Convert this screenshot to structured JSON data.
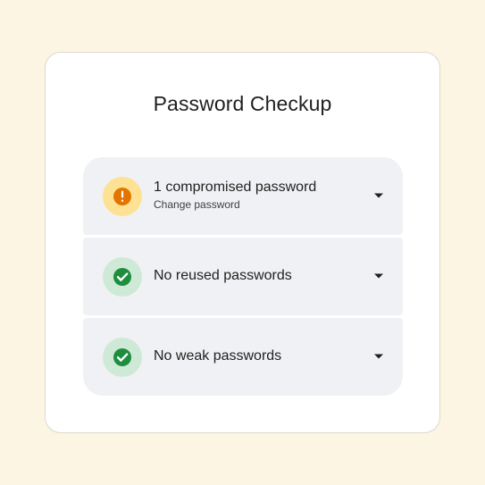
{
  "title": "Password Checkup",
  "items": [
    {
      "label": "1 compromised password",
      "sublabel": "Change password",
      "status": "warning",
      "status_icon": "exclamation-icon"
    },
    {
      "label": "No reused passwords",
      "status": "ok",
      "status_icon": "check-icon"
    },
    {
      "label": "No weak passwords",
      "status": "ok",
      "status_icon": "check-icon"
    }
  ],
  "colors": {
    "background": "#fdf5e3",
    "warning_bg": "#fde293",
    "warning_fg": "#e37400",
    "ok_bg": "#ceead6",
    "ok_fg": "#1e8e3e"
  }
}
